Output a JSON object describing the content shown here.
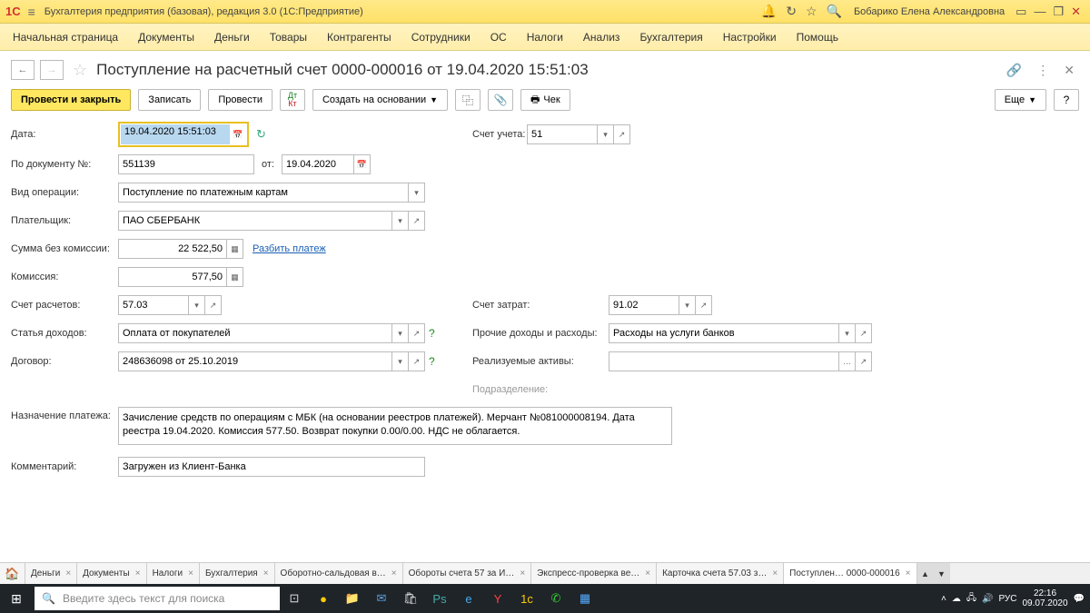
{
  "titlebar": {
    "logo": "1C",
    "title": "Бухгалтерия предприятия (базовая), редакция 3.0  (1С:Предприятие)",
    "user": "Бобарико Елена Александровна"
  },
  "menu": [
    "Начальная страница",
    "Документы",
    "Деньги",
    "Товары",
    "Контрагенты",
    "Сотрудники",
    "ОС",
    "Налоги",
    "Анализ",
    "Бухгалтерия",
    "Настройки",
    "Помощь"
  ],
  "doc": {
    "title": "Поступление на расчетный счет 0000-000016 от 19.04.2020 15:51:03"
  },
  "toolbar": {
    "primary": "Провести и закрыть",
    "save": "Записать",
    "post": "Провести",
    "create_based": "Создать на основании",
    "cheque": "Чек",
    "more": "Еще"
  },
  "form": {
    "date_label": "Дата:",
    "date_value": "19.04.2020 15:51:03",
    "account_label": "Счет учета:",
    "account_value": "51",
    "docnum_label": "По документу №:",
    "docnum_value": "551139",
    "from_label": "от:",
    "from_value": "19.04.2020",
    "optype_label": "Вид операции:",
    "optype_value": "Поступление по платежным картам",
    "payer_label": "Плательщик:",
    "payer_value": "ПАО СБЕРБАНК",
    "sum_label": "Сумма без комиссии:",
    "sum_value": "22 522,50",
    "split_link": "Разбить платеж",
    "commission_label": "Комиссия:",
    "commission_value": "577,50",
    "settlement_label": "Счет расчетов:",
    "settlement_value": "57.03",
    "expense_label": "Счет затрат:",
    "expense_value": "91.02",
    "income_art_label": "Статья доходов:",
    "income_art_value": "Оплата от покупателей",
    "other_label": "Прочие доходы и расходы:",
    "other_value": "Расходы на услуги банков",
    "contract_label": "Договор:",
    "contract_value": "248636098 от 25.10.2019",
    "assets_label": "Реализуемые активы:",
    "assets_value": "",
    "subdiv_label": "Подразделение:",
    "purpose_label": "Назначение платежа:",
    "purpose_value": "Зачисление средств по операциям с МБК (на основании реестров платежей). Мерчант №081000008194. Дата реестра 19.04.2020. Комиссия 577.50. Возврат покупки 0.00/0.00. НДС не облагается.",
    "comment_label": "Комментарий:",
    "comment_value": "Загружен из Клиент-Банка"
  },
  "tabs": [
    "Деньги",
    "Документы",
    "Налоги",
    "Бухгалтерия",
    "Оборотно-сальдовая в…",
    "Обороты счета 57 за И…",
    "Экспресс-проверка ве…",
    "Карточка счета 57.03 з…",
    "Поступлен… 0000-000016"
  ],
  "taskbar": {
    "search_placeholder": "Введите здесь текст для поиска",
    "lang": "РУС",
    "time": "22:16",
    "date": "09.07.2020"
  }
}
